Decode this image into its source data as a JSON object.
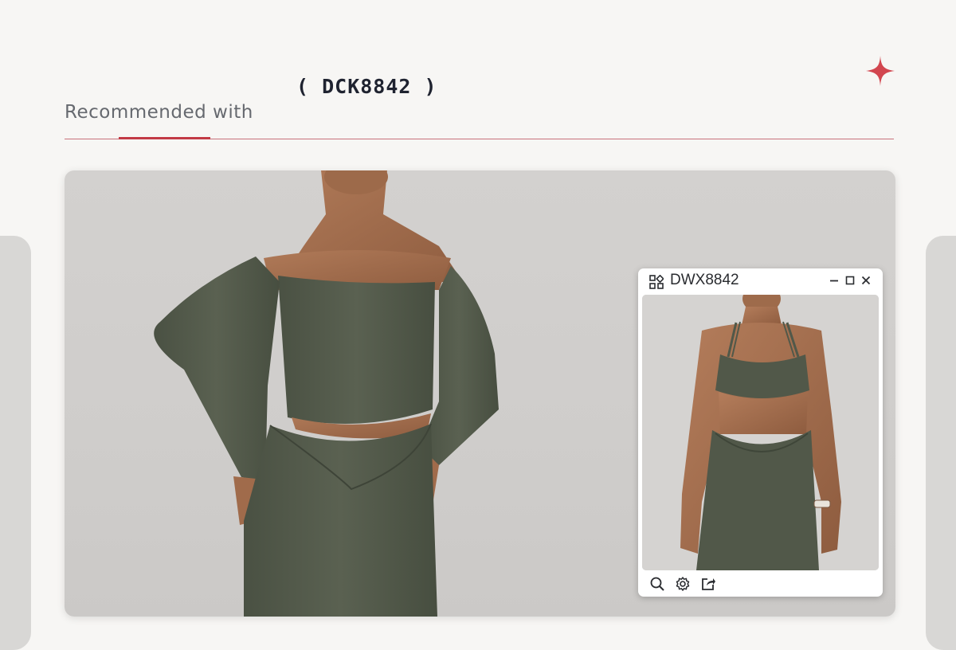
{
  "header": {
    "title": "Recommended with",
    "product_code": "( DCK8842 )",
    "accent_color": "#c23a45",
    "sparkle_color": "#d2464f"
  },
  "main_image": {
    "garment_color": "#515849"
  },
  "viewer": {
    "title": "DWX8842",
    "icons": [
      "grid-icon",
      "minimize-icon",
      "maximize-icon",
      "close-icon"
    ],
    "toolbar_icons": [
      "zoom-icon",
      "gear-icon",
      "share-icon"
    ]
  }
}
